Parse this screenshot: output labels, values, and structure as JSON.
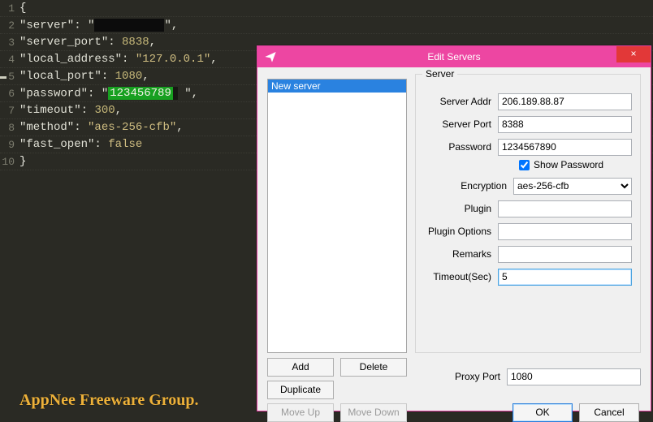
{
  "editor": {
    "lines": [
      {
        "n": 1,
        "parts": [
          {
            "t": "br",
            "v": "{"
          }
        ]
      },
      {
        "n": 2,
        "parts": [
          {
            "t": "key",
            "v": "\"server\""
          },
          {
            "t": "colon",
            "v": ": \""
          },
          {
            "t": "redact",
            "w": 86
          },
          {
            "t": "colon",
            "v": "\","
          }
        ]
      },
      {
        "n": 3,
        "parts": [
          {
            "t": "key",
            "v": "\"server_port\""
          },
          {
            "t": "colon",
            "v": ": "
          },
          {
            "t": "num",
            "v": "8838"
          },
          {
            "t": "colon",
            "v": ","
          }
        ]
      },
      {
        "n": 4,
        "parts": [
          {
            "t": "key",
            "v": "\"local_address\""
          },
          {
            "t": "colon",
            "v": ": "
          },
          {
            "t": "str",
            "v": "\"127.0.0.1\""
          },
          {
            "t": "colon",
            "v": ","
          }
        ]
      },
      {
        "n": 5,
        "parts": [
          {
            "t": "key",
            "v": "\"local_port\""
          },
          {
            "t": "colon",
            "v": ": "
          },
          {
            "t": "num",
            "v": "1080"
          },
          {
            "t": "colon",
            "v": ","
          }
        ]
      },
      {
        "n": 6,
        "parts": [
          {
            "t": "key",
            "v": "\"password\""
          },
          {
            "t": "colon",
            "v": ": \""
          },
          {
            "t": "hl",
            "v": "123456789"
          },
          {
            "t": "caret"
          },
          {
            "t": "colon",
            "v": " \","
          }
        ]
      },
      {
        "n": 7,
        "parts": [
          {
            "t": "key",
            "v": "\"timeout\""
          },
          {
            "t": "colon",
            "v": ": "
          },
          {
            "t": "num",
            "v": "300"
          },
          {
            "t": "colon",
            "v": ","
          }
        ]
      },
      {
        "n": 8,
        "parts": [
          {
            "t": "key",
            "v": "\"method\""
          },
          {
            "t": "colon",
            "v": ": "
          },
          {
            "t": "str",
            "v": "\"aes-256-cfb\""
          },
          {
            "t": "colon",
            "v": ","
          }
        ]
      },
      {
        "n": 9,
        "parts": [
          {
            "t": "key",
            "v": "\"fast_open\""
          },
          {
            "t": "colon",
            "v": ": "
          },
          {
            "t": "false",
            "v": "false"
          }
        ]
      },
      {
        "n": 10,
        "parts": [
          {
            "t": "br",
            "v": "}"
          }
        ]
      }
    ]
  },
  "watermark": "AppNee Freeware Group.",
  "dialog": {
    "title": "Edit Servers",
    "close": "×",
    "list_item": "New server",
    "group_label": "Server",
    "labels": {
      "server_addr": "Server Addr",
      "server_port": "Server Port",
      "password": "Password",
      "show_password": "Show Password",
      "encryption": "Encryption",
      "plugin": "Plugin",
      "plugin_options": "Plugin Options",
      "remarks": "Remarks",
      "timeout": "Timeout(Sec)",
      "proxy_port": "Proxy Port"
    },
    "values": {
      "server_addr": "206.189.88.87",
      "server_port": "8388",
      "password": "1234567890",
      "encryption": "aes-256-cfb",
      "plugin": "",
      "plugin_options": "",
      "remarks": "",
      "timeout": "5",
      "proxy_port": "1080"
    },
    "buttons": {
      "add": "Add",
      "delete": "Delete",
      "duplicate": "Duplicate",
      "move_up": "Move Up",
      "move_down": "Move Down",
      "ok": "OK",
      "cancel": "Cancel"
    }
  }
}
